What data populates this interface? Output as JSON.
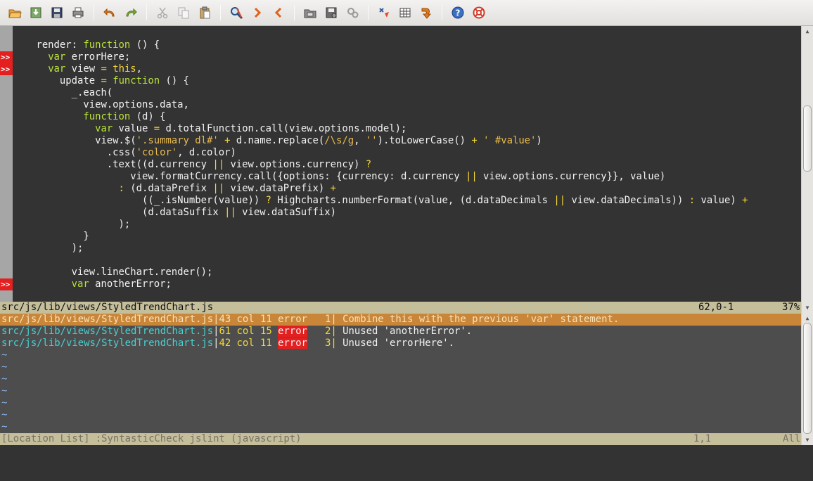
{
  "toolbar": {
    "buttons": [
      "open-icon",
      "save-down-icon",
      "save-icon",
      "print-icon",
      "undo-icon",
      "redo-icon",
      "cut-icon",
      "copy-icon",
      "paste-icon",
      "find-replace-icon",
      "find-next-icon",
      "find-prev-icon",
      "load-session-icon",
      "save-session-icon",
      "run-script-icon",
      "make-icon",
      "shell-icon",
      "tag-jump-icon",
      "help-icon",
      "find-help-icon"
    ]
  },
  "editor": {
    "lines": [
      {
        "sign": "",
        "code": [
          [
            "    render: ",
            ""
          ],
          [
            "function",
            "kw"
          ],
          [
            " () {",
            ""
          ]
        ]
      },
      {
        "sign": ">>",
        "code": [
          [
            "      ",
            ""
          ],
          [
            "var",
            "kw"
          ],
          [
            " errorHere;",
            ""
          ]
        ]
      },
      {
        "sign": ">>",
        "code": [
          [
            "      ",
            ""
          ],
          [
            "var",
            "kw"
          ],
          [
            " view ",
            ""
          ],
          [
            "=",
            "op"
          ],
          [
            " ",
            ""
          ],
          [
            "this",
            "th"
          ],
          [
            ",",
            ""
          ]
        ]
      },
      {
        "sign": "",
        "code": [
          [
            "        update ",
            ""
          ],
          [
            "=",
            "op"
          ],
          [
            " ",
            ""
          ],
          [
            "function",
            "kw"
          ],
          [
            " () {",
            ""
          ]
        ]
      },
      {
        "sign": "",
        "code": [
          [
            "          _.each(",
            ""
          ]
        ]
      },
      {
        "sign": "",
        "code": [
          [
            "            view.options.data,",
            ""
          ]
        ]
      },
      {
        "sign": "",
        "code": [
          [
            "            ",
            ""
          ],
          [
            "function",
            "kw"
          ],
          [
            " (d) {",
            ""
          ]
        ]
      },
      {
        "sign": "",
        "code": [
          [
            "              ",
            ""
          ],
          [
            "var",
            "kw"
          ],
          [
            " value ",
            ""
          ],
          [
            "=",
            "op"
          ],
          [
            " d.totalFunction.call(view.options.model);",
            ""
          ]
        ]
      },
      {
        "sign": "",
        "code": [
          [
            "              view.$(",
            ""
          ],
          [
            "'.summary dl#'",
            "str"
          ],
          [
            " ",
            ""
          ],
          [
            "+",
            "op"
          ],
          [
            " d.name.replace(",
            ""
          ],
          [
            "/\\s/g",
            "str"
          ],
          [
            ", ",
            ""
          ],
          [
            "''",
            "str"
          ],
          [
            ").toLowerCase() ",
            ""
          ],
          [
            "+",
            "op"
          ],
          [
            " ",
            ""
          ],
          [
            "' #value'",
            "str"
          ],
          [
            ")",
            ""
          ]
        ]
      },
      {
        "sign": "",
        "code": [
          [
            "                .css(",
            ""
          ],
          [
            "'color'",
            "str"
          ],
          [
            ", d.color)",
            ""
          ]
        ]
      },
      {
        "sign": "",
        "code": [
          [
            "                .text((d.currency ",
            ""
          ],
          [
            "||",
            "op"
          ],
          [
            " view.options.currency) ",
            ""
          ],
          [
            "?",
            "op"
          ],
          [
            "",
            ""
          ]
        ]
      },
      {
        "sign": "",
        "code": [
          [
            "                    view.formatCurrency.call({options: {currency: d.currency ",
            ""
          ],
          [
            "||",
            "op"
          ],
          [
            " view.options.currency}}, value)",
            ""
          ]
        ]
      },
      {
        "sign": "",
        "code": [
          [
            "                  ",
            ""
          ],
          [
            ":",
            "op"
          ],
          [
            " (d.dataPrefix ",
            ""
          ],
          [
            "||",
            "op"
          ],
          [
            " view.dataPrefix) ",
            ""
          ],
          [
            "+",
            "op"
          ],
          [
            "",
            ""
          ]
        ]
      },
      {
        "sign": "",
        "code": [
          [
            "                      ((_.isNumber(value)) ",
            ""
          ],
          [
            "?",
            "op"
          ],
          [
            " Highcharts.numberFormat(value, (d.dataDecimals ",
            ""
          ],
          [
            "||",
            "op"
          ],
          [
            " view.dataDecimals)) ",
            ""
          ],
          [
            ":",
            "op"
          ],
          [
            " value) ",
            ""
          ],
          [
            "+",
            "op"
          ],
          [
            "",
            ""
          ]
        ]
      },
      {
        "sign": "",
        "code": [
          [
            "                      (d.dataSuffix ",
            ""
          ],
          [
            "||",
            "op"
          ],
          [
            " view.dataSuffix)",
            ""
          ]
        ]
      },
      {
        "sign": "",
        "code": [
          [
            "                  );",
            ""
          ]
        ]
      },
      {
        "sign": "",
        "code": [
          [
            "            }",
            ""
          ]
        ]
      },
      {
        "sign": "",
        "code": [
          [
            "          );",
            ""
          ]
        ]
      },
      {
        "sign": "",
        "code": [
          [
            "",
            ""
          ]
        ]
      },
      {
        "sign": "",
        "code": [
          [
            "          view.lineChart.render();",
            ""
          ]
        ]
      },
      {
        "sign": ">>",
        "code": [
          [
            "          ",
            ""
          ],
          [
            "var",
            "kw"
          ],
          [
            " anotherError;",
            ""
          ]
        ]
      }
    ]
  },
  "status": {
    "file": "src/js/lib/views/StyledTrendChart.js",
    "position": "62,0-1",
    "percent": "37%"
  },
  "location_list": {
    "items": [
      {
        "file": "src/js/lib/views/StyledTrendChart.js",
        "sep": "|",
        "loc": "43 col 11",
        "type": "error",
        "num": "1|",
        "msg": " Combine this with the previous 'var' statement."
      },
      {
        "file": "src/js/lib/views/StyledTrendChart.js",
        "sep": "|",
        "loc": "61 col 15",
        "type": "error",
        "num": "2|",
        "msg": " Unused 'anotherError'."
      },
      {
        "file": "src/js/lib/views/StyledTrendChart.js",
        "sep": "|",
        "loc": "42 col 11",
        "type": "error",
        "num": "3|",
        "msg": " Unused 'errorHere'."
      }
    ],
    "tilde": "~",
    "tilde_count": 7
  },
  "status2": {
    "title": "[Location List] :SyntasticCheck jslint (javascript)",
    "position": "1,1",
    "percent": "All"
  }
}
